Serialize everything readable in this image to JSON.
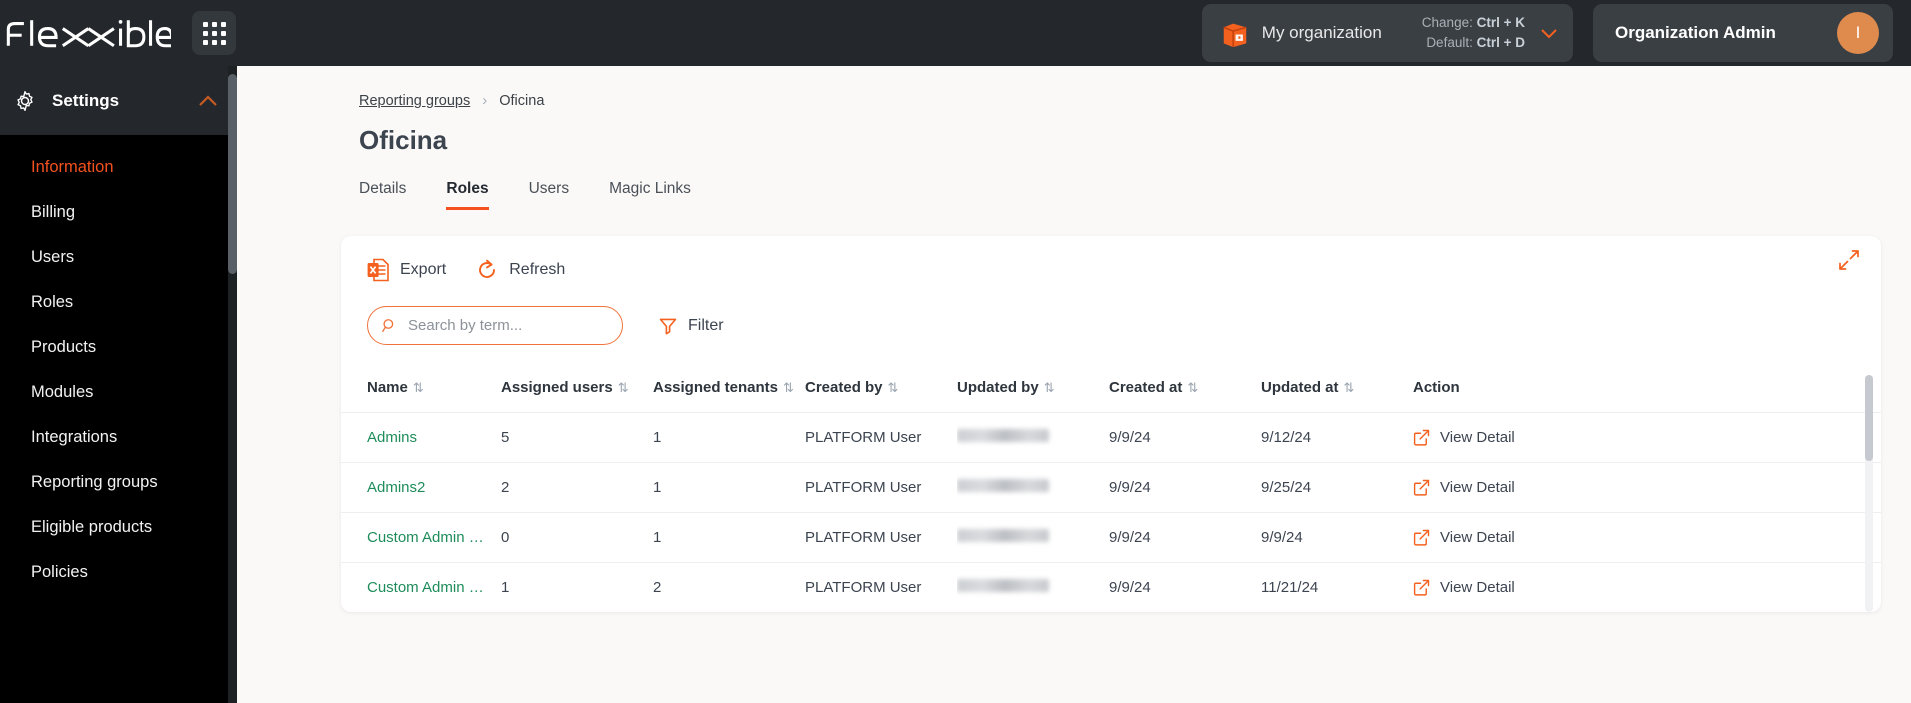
{
  "header": {
    "logo_text": "flexxible",
    "apps_icon": "grid-apps-icon",
    "organization": {
      "icon": "box-icon",
      "name": "My organization",
      "shortcut_change_label": "Change:",
      "shortcut_change_keys": "Ctrl + K",
      "shortcut_default_label": "Default:",
      "shortcut_default_keys": "Ctrl + D"
    },
    "account": {
      "role_title": "Organization Admin",
      "avatar_initial": "I"
    }
  },
  "sidebar": {
    "section_title": "Settings",
    "items": [
      {
        "label": "Information",
        "active": true
      },
      {
        "label": "Billing",
        "active": false
      },
      {
        "label": "Users",
        "active": false
      },
      {
        "label": "Roles",
        "active": false
      },
      {
        "label": "Products",
        "active": false
      },
      {
        "label": "Modules",
        "active": false
      },
      {
        "label": "Integrations",
        "active": false
      },
      {
        "label": "Reporting groups",
        "active": false
      },
      {
        "label": "Eligible products",
        "active": false
      },
      {
        "label": "Policies",
        "active": false
      }
    ]
  },
  "breadcrumb": {
    "parent": "Reporting groups",
    "separator": "›",
    "current": "Oficina"
  },
  "page": {
    "title": "Oficina"
  },
  "tabs": [
    {
      "label": "Details",
      "active": false
    },
    {
      "label": "Roles",
      "active": true
    },
    {
      "label": "Users",
      "active": false
    },
    {
      "label": "Magic Links",
      "active": false
    }
  ],
  "toolbar": {
    "export_label": "Export",
    "refresh_label": "Refresh",
    "expand_icon": "expand-arrows-icon"
  },
  "search": {
    "value": "",
    "placeholder": "Search by term...",
    "filter_label": "Filter"
  },
  "table": {
    "columns": [
      "Name",
      "Assigned users",
      "Assigned tenants",
      "Created by",
      "Updated by",
      "Created at",
      "Updated at",
      "Action"
    ],
    "action_label": "View Detail",
    "rows": [
      {
        "name": "Admins",
        "assigned_users": "5",
        "assigned_tenants": "1",
        "created_by": "PLATFORM User",
        "updated_by": "",
        "created_at": "9/9/24",
        "updated_at": "9/12/24"
      },
      {
        "name": "Admins2",
        "assigned_users": "2",
        "assigned_tenants": "1",
        "created_by": "PLATFORM User",
        "updated_by": "",
        "created_at": "9/9/24",
        "updated_at": "9/25/24"
      },
      {
        "name": "Custom Admin Rol...",
        "assigned_users": "0",
        "assigned_tenants": "1",
        "created_by": "PLATFORM User",
        "updated_by": "",
        "created_at": "9/9/24",
        "updated_at": "9/9/24"
      },
      {
        "name": "Custom Admin Rol...",
        "assigned_users": "1",
        "assigned_tenants": "2",
        "created_by": "PLATFORM User",
        "updated_by": "",
        "created_at": "9/9/24",
        "updated_at": "11/21/24"
      }
    ]
  },
  "colors": {
    "accent": "#f4511e",
    "accent_soft": "#f0733c",
    "link_green": "#1e8c5a",
    "topbar_bg": "#24282c",
    "sidebar_bg": "#000000",
    "canvas_bg": "#faf9f7"
  }
}
